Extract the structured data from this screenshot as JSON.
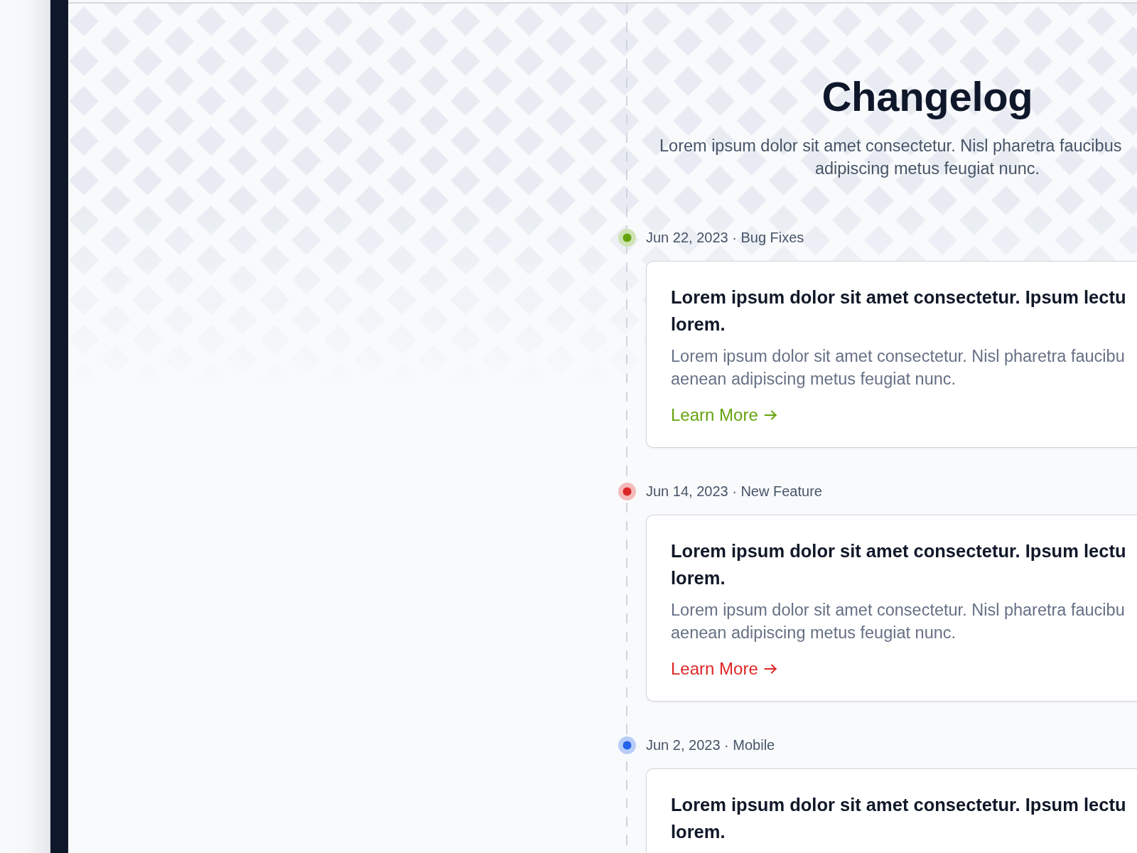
{
  "header": {
    "title": "Changelog",
    "subtitle_lines": [
      "Lorem ipsum dolor sit amet consectetur. Nisl pharetra faucibus",
      "adipiscing metus feugiat nunc."
    ]
  },
  "entries": [
    {
      "meta": "Jun 22, 2023 · Bug Fixes",
      "color": "#65a30d",
      "card": {
        "title_lines": [
          "Lorem ipsum dolor sit amet consectetur. Ipsum lectu",
          "lorem."
        ],
        "body_lines": [
          "Lorem ipsum dolor sit amet consectetur. Nisl pharetra faucibu",
          "aenean adipiscing metus feugiat nunc."
        ],
        "link": "Learn More"
      }
    },
    {
      "meta": "Jun 14, 2023 · New Feature",
      "color": "#dc2626",
      "card": {
        "title_lines": [
          "Lorem ipsum dolor sit amet consectetur. Ipsum lectu",
          "lorem."
        ],
        "body_lines": [
          "Lorem ipsum dolor sit amet consectetur. Nisl pharetra faucibu",
          "aenean adipiscing metus feugiat nunc."
        ],
        "link": "Learn More"
      }
    },
    {
      "meta": "Jun 2, 2023 · Mobile",
      "color": "#2563eb",
      "card": {
        "title_lines": [
          "Lorem ipsum dolor sit amet consectetur. Ipsum lectu",
          "lorem."
        ]
      }
    }
  ]
}
